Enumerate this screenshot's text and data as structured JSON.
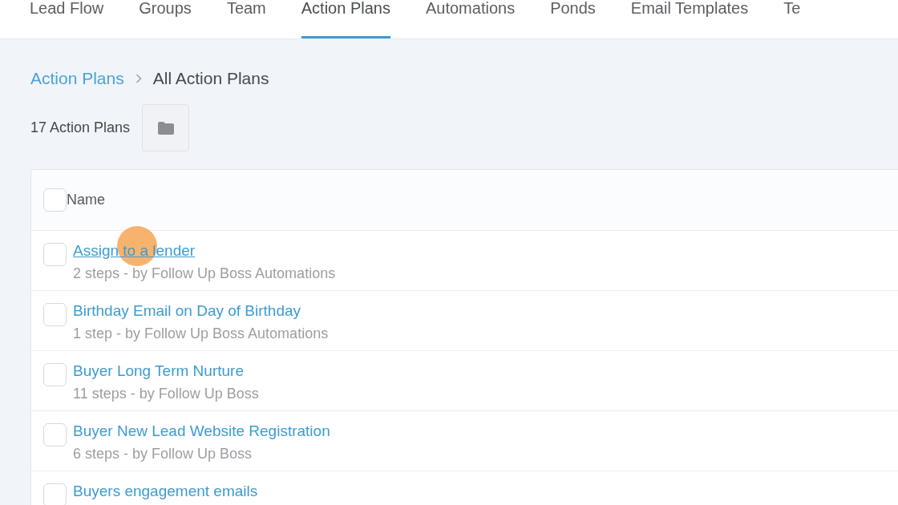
{
  "nav_tabs": [
    {
      "label": "Lead Flow",
      "selected": false
    },
    {
      "label": "Groups",
      "selected": false
    },
    {
      "label": "Team",
      "selected": false
    },
    {
      "label": "Action Plans",
      "selected": true
    },
    {
      "label": "Automations",
      "selected": false
    },
    {
      "label": "Ponds",
      "selected": false
    },
    {
      "label": "Email Templates",
      "selected": false
    },
    {
      "label": "Te",
      "selected": false
    }
  ],
  "breadcrumb": {
    "parent": "Action Plans",
    "current": "All Action Plans"
  },
  "toolbar": {
    "count": "17 Action Plans"
  },
  "table": {
    "header": {
      "label": "Name",
      "checked": false
    },
    "rows": [
      {
        "title": "Assign to a lender",
        "subtitle": "2 steps - by Follow Up Boss Automations",
        "checked": false,
        "hovered": true
      },
      {
        "title": "Birthday Email on Day of Birthday",
        "subtitle": "1 step - by Follow Up Boss Automations",
        "checked": false,
        "hovered": false
      },
      {
        "title": "Buyer Long Term Nurture",
        "subtitle": "11 steps - by Follow Up Boss",
        "checked": false,
        "hovered": false
      },
      {
        "title": "Buyer New Lead Website Registration",
        "subtitle": "6 steps - by Follow Up Boss",
        "checked": false,
        "hovered": false
      },
      {
        "title": "Buyers engagement emails",
        "checked": false,
        "hovered": false
      }
    ]
  }
}
